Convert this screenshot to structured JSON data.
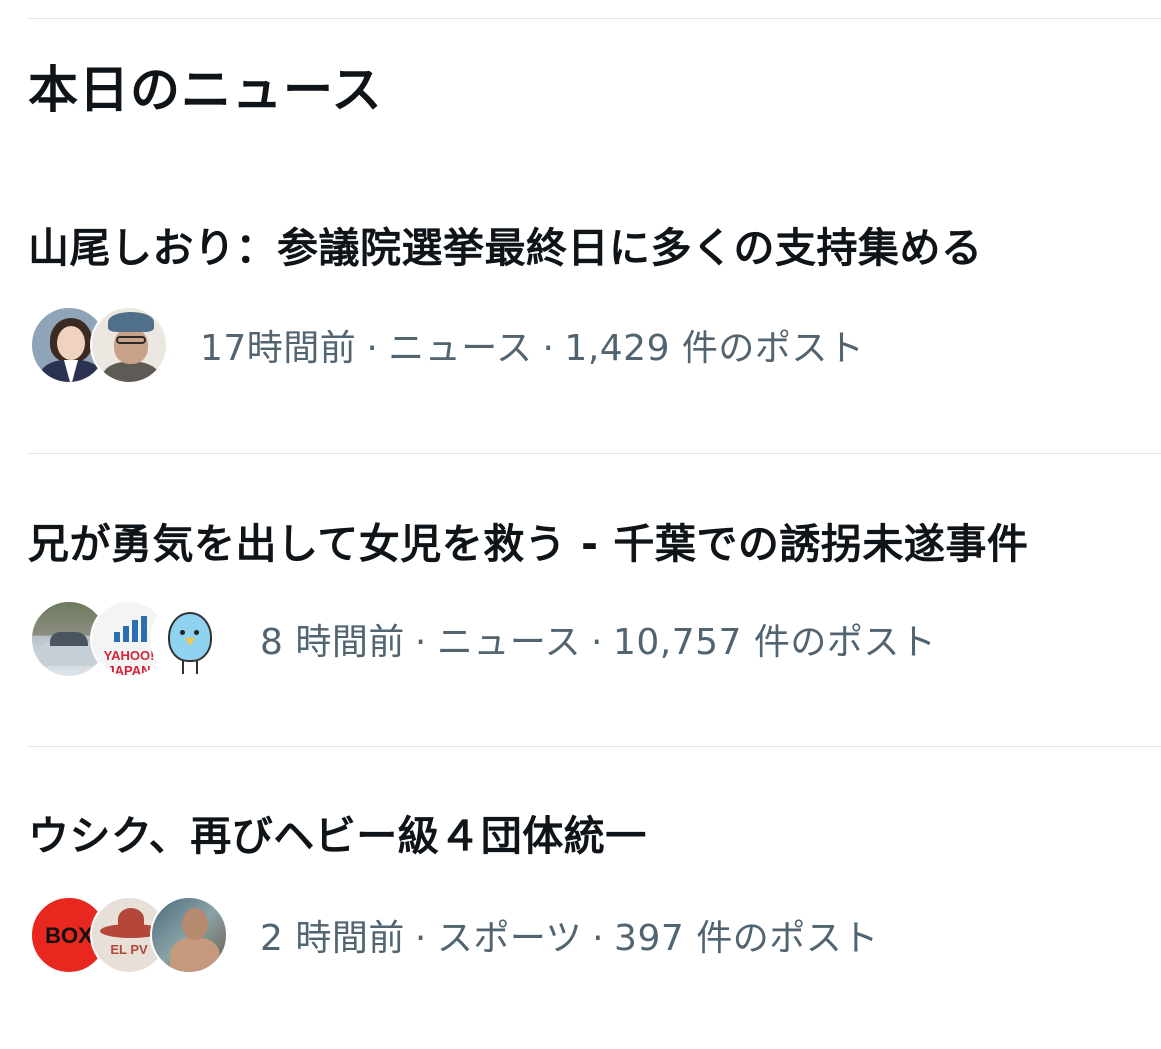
{
  "section": {
    "title": "本日のニュース"
  },
  "news": [
    {
      "headline": "山尾しおり：参議院選挙最終日に多くの支持集める",
      "time": "17時間前",
      "category": "ニュース",
      "posts": "1,429 件のポスト",
      "separator": "·"
    },
    {
      "headline": "兄が勇気を出して女児を救う - 千葉での誘拐未遂事件",
      "time": "8 時間前",
      "category": "ニュース",
      "posts": "10,757 件のポスト",
      "separator": "·"
    },
    {
      "headline": "ウシク、再びヘビー級４団体統一",
      "time": "2 時間前",
      "category": "スポーツ",
      "posts": "397 件のポスト",
      "separator": "·"
    }
  ],
  "avatars": {
    "yahoo_logo_text": "YAHOO! JAPAN",
    "box_logo_text": "BOX",
    "sombrero_logo_text": "EL PV"
  },
  "colors": {
    "text_primary": "#0f1419",
    "text_secondary": "#536471",
    "divider": "#e1e6ea"
  }
}
